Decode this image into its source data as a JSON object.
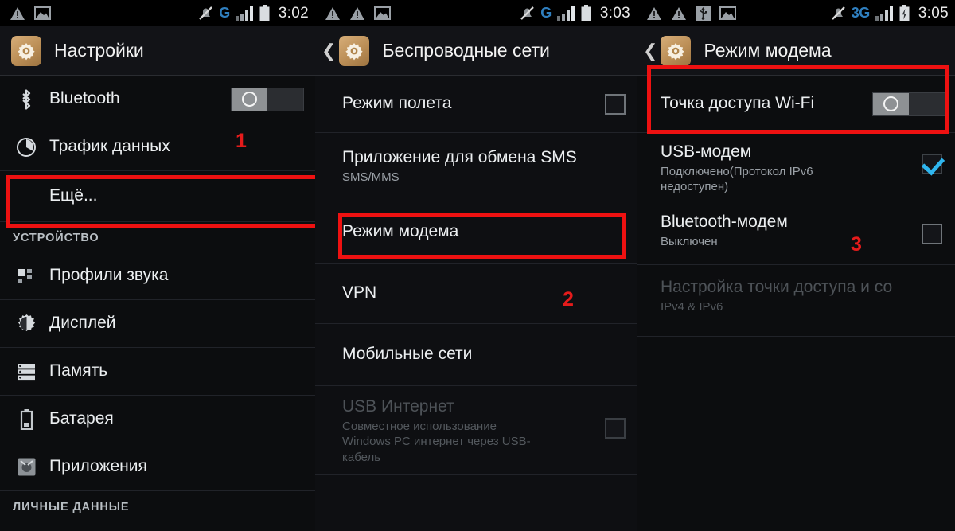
{
  "panels": [
    {
      "statusbar": {
        "left_icons": [
          "warning-triangle-icon",
          "picture-icon"
        ],
        "mute_icon": "bell-muted-icon",
        "network": "G",
        "battery": "battery-icon",
        "time": "3:02"
      },
      "header": {
        "title": "Настройки",
        "icon": "settings-gear-icon",
        "has_back": false
      },
      "items": [
        {
          "title": "Bluetooth",
          "icon": "bluetooth-icon",
          "control": "switch-off"
        },
        {
          "title": "Трафик данных",
          "icon": "data-usage-icon",
          "control": "none"
        },
        {
          "title": "Ещё...",
          "icon": "none",
          "control": "none",
          "indent": true,
          "highlight": true
        },
        {
          "section": "УСТРОЙСТВО"
        },
        {
          "title": "Профили звука",
          "icon": "sound-profiles-icon",
          "control": "none"
        },
        {
          "title": "Дисплей",
          "icon": "display-icon",
          "control": "none"
        },
        {
          "title": "Память",
          "icon": "storage-icon",
          "control": "none"
        },
        {
          "title": "Батарея",
          "icon": "battery-settings-icon",
          "control": "none"
        },
        {
          "title": "Приложения",
          "icon": "apps-android-icon",
          "control": "none"
        },
        {
          "section": "ЛИЧНЫЕ ДАННЫЕ"
        }
      ],
      "annotation": {
        "number": "1"
      }
    },
    {
      "statusbar": {
        "left_icons": [
          "warning-triangle-icon",
          "warning-triangle-icon",
          "picture-icon"
        ],
        "mute_icon": "bell-muted-icon",
        "network": "G",
        "battery": "battery-icon",
        "time": "3:03"
      },
      "header": {
        "title": "Беспроводные сети",
        "icon": "settings-gear-icon",
        "has_back": true
      },
      "items": [
        {
          "title": "Режим полета",
          "sub": "",
          "control": "checkbox-unchecked"
        },
        {
          "title": "Приложение для обмена SMS",
          "sub": "SMS/MMS",
          "control": "none"
        },
        {
          "title": "Режим модема",
          "sub": "",
          "control": "none",
          "highlight": true
        },
        {
          "title": "VPN",
          "sub": "",
          "control": "none"
        },
        {
          "title": "Мобильные сети",
          "sub": "",
          "control": "none"
        },
        {
          "title": "USB Интернет",
          "sub": "Совместное использование Windows PC интернет через USB-кабель",
          "control": "checkbox-unchecked",
          "dim": true
        }
      ],
      "annotation": {
        "number": "2"
      }
    },
    {
      "statusbar": {
        "left_icons": [
          "warning-triangle-icon",
          "warning-triangle-icon",
          "usb-icon",
          "picture-icon"
        ],
        "mute_icon": "bell-muted-icon",
        "network": "3G",
        "battery": "battery-charging-icon",
        "time": "3:05"
      },
      "header": {
        "title": "Режим модема",
        "icon": "settings-gear-icon",
        "has_back": true
      },
      "items": [
        {
          "title": "Точка доступа Wi-Fi",
          "sub": "",
          "control": "switch-off"
        },
        {
          "title": "USB-модем",
          "sub": "Подключено(Протокол IPv6 недоступен)",
          "control": "checkbox-checked",
          "highlight": true
        },
        {
          "title": "Bluetooth-модем",
          "sub": "Выключен",
          "control": "checkbox-unchecked"
        },
        {
          "title": "Настройка точки доступа и со",
          "sub": "IPv4 & IPv6",
          "control": "none",
          "dim": true
        }
      ],
      "annotation": {
        "number": "3"
      }
    }
  ],
  "colors": {
    "accent_red": "#ee1111",
    "checkbox_check": "#2fb6ef",
    "network_blue": "#2f7fbf",
    "app_icon_gold": "#bb8e56"
  }
}
